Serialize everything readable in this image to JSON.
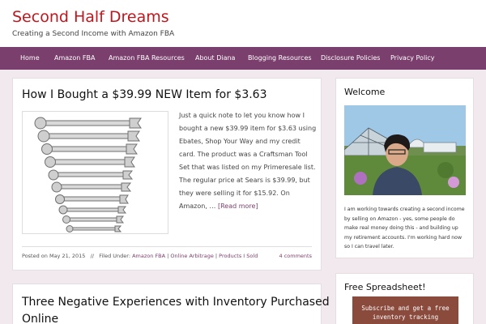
{
  "site": {
    "title": "Second Half Dreams",
    "tagline": "Creating a Second Income with Amazon FBA"
  },
  "nav": {
    "items": [
      "Home",
      "Amazon FBA",
      "Amazon FBA Resources",
      "About Diana",
      "Blogging Resources",
      "Disclosure Policies",
      "Privacy Policy"
    ]
  },
  "post1": {
    "title": "How I Bought a $39.99 NEW Item for $3.63",
    "excerpt": "Just a quick note to let you know how I bought a new $39.99 item for $3.63 using Ebates, Shop Your Way and my credit card. The product was a Craftsman Tool Set that was listed on my Primeresale list.  The regular price at Sears is $39.99, but they were selling it for $15.92.  On Amazon, …",
    "read_more": "[Read more]",
    "meta": {
      "posted_on": "Posted on May 21, 2015",
      "separator": "//",
      "filed_under": "Filed Under:",
      "categories": [
        "Amazon FBA",
        "Online Arbitrage",
        "Products I Sold"
      ],
      "comments": "4 comments"
    }
  },
  "post2": {
    "title_line1": "Three Negative Experiences with Inventory Purchased",
    "title_line2": "Online"
  },
  "sidebar": {
    "welcome": {
      "title": "Welcome",
      "text": "I am working towards creating a second income by selling on Amazon - yes, some people do make real money doing this - and building up my retirement accounts. I'm working hard now so I can travel later."
    },
    "spreadsheet": {
      "title": "Free Spreadsheet!",
      "cta": "Subscribe and get a free inventory tracking"
    }
  },
  "colors": {
    "brand_red": "#c0161d",
    "nav_purple": "#7b3f6e",
    "page_bg": "#f1e9ee",
    "cta_brown": "#8a4a3c"
  }
}
